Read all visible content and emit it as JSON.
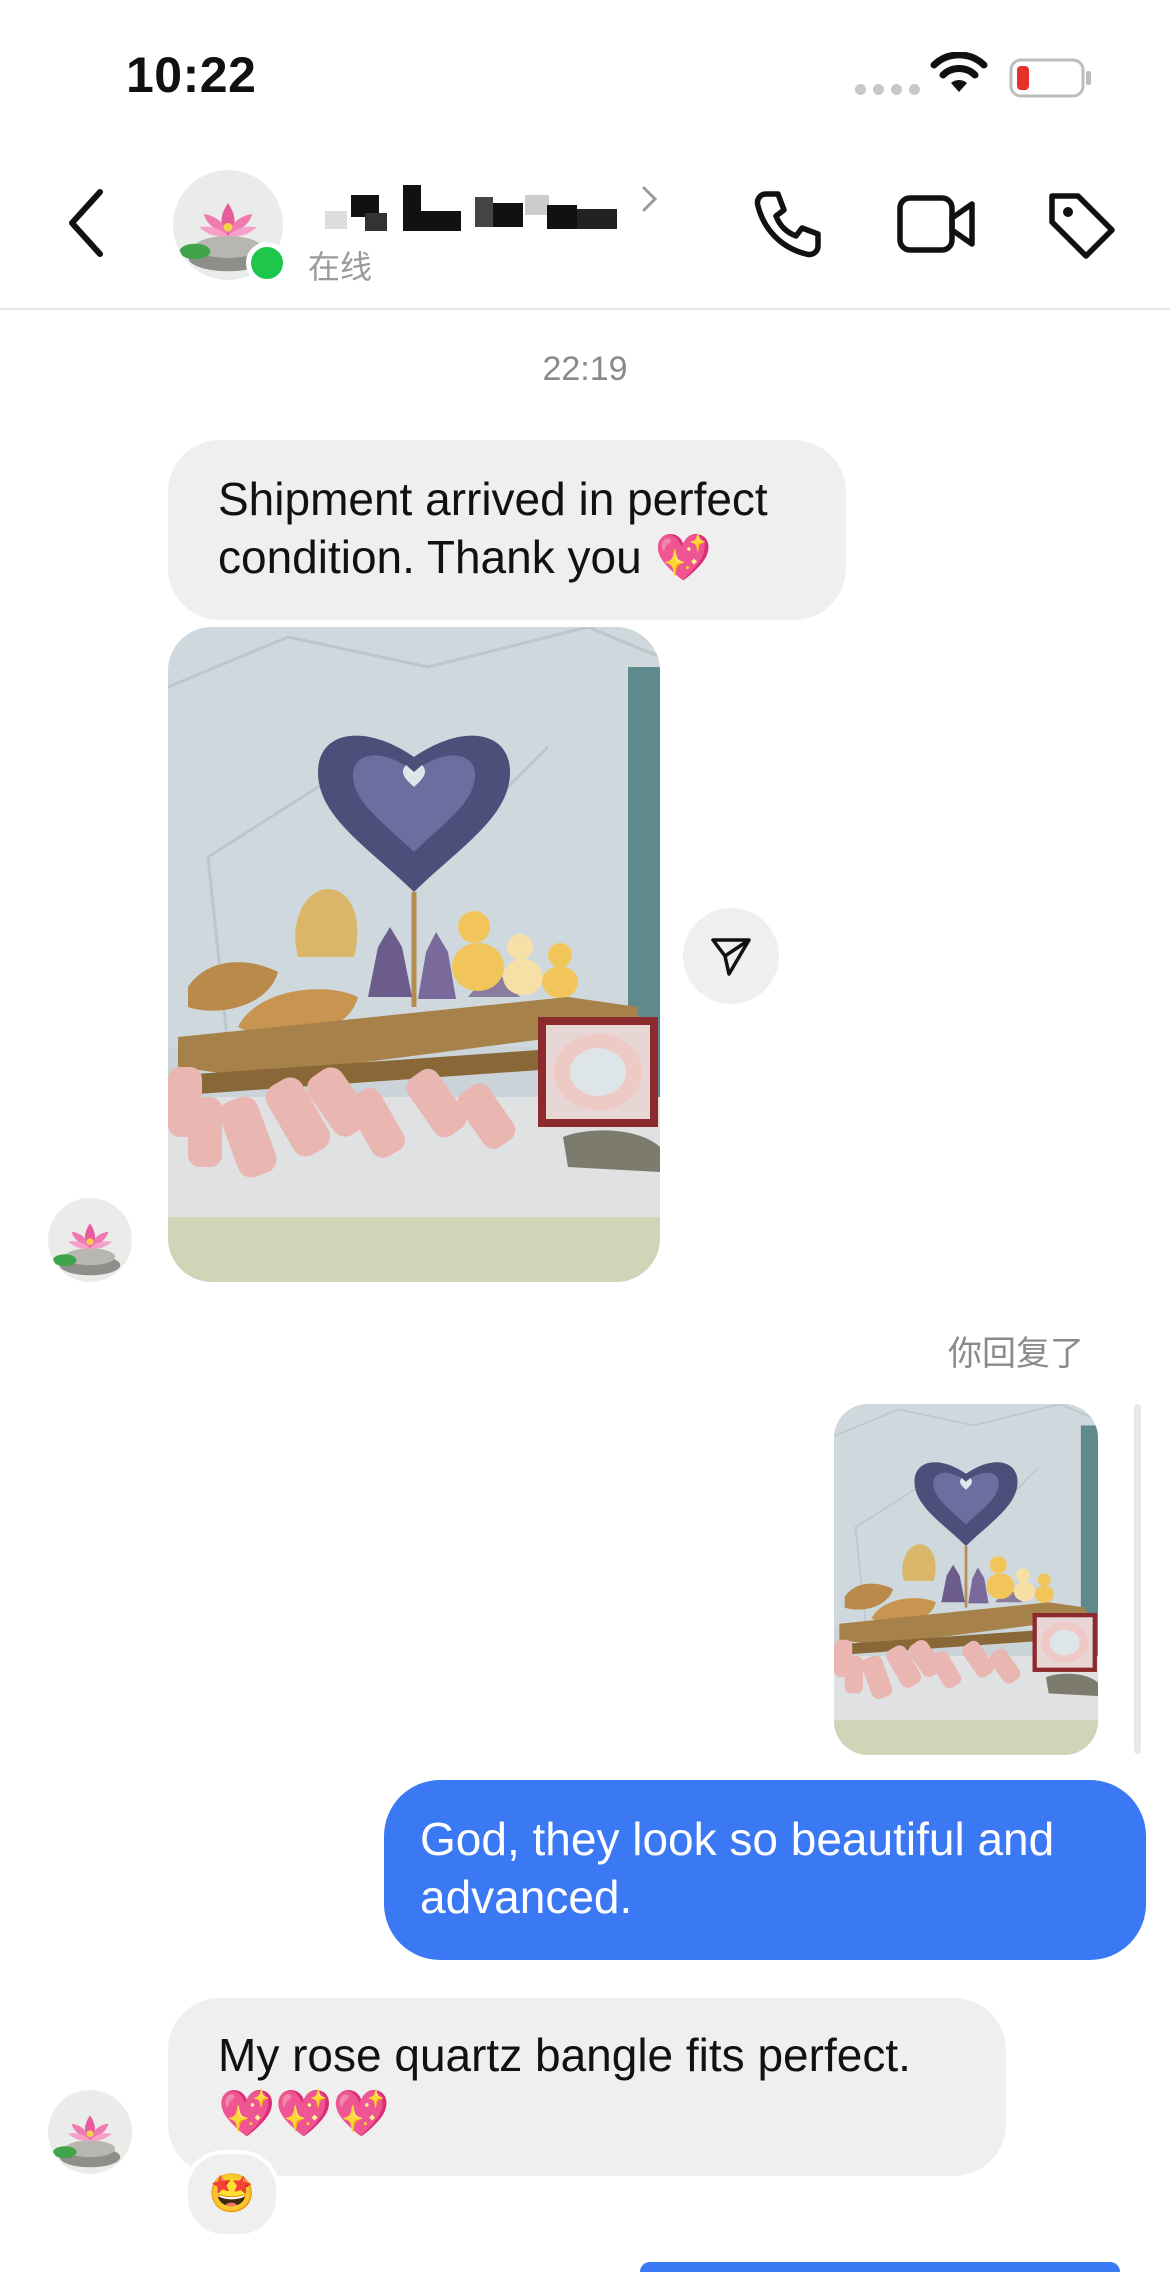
{
  "status_bar": {
    "time": "10:22"
  },
  "header": {
    "contact_status": "在线",
    "colors": {
      "online": "#1ec74b"
    },
    "icons": [
      "chevron-left-icon",
      "phone-icon",
      "video-camera-icon",
      "tag-icon",
      "chevron-right-icon"
    ]
  },
  "chat": {
    "timestamp": "22:19",
    "messages": [
      {
        "from": "them",
        "type": "text",
        "text": "Shipment arrived in perfect condition. Thank you 💖"
      },
      {
        "from": "them",
        "type": "photo",
        "description": "crystals on wooden shelf"
      },
      {
        "from": "me",
        "type": "reply_label",
        "text": "你回复了"
      },
      {
        "from": "me",
        "type": "photo_reply"
      },
      {
        "from": "me",
        "type": "text",
        "text": "God, they look so beautiful and advanced."
      },
      {
        "from": "them",
        "type": "text",
        "text": "My rose quartz bangle fits perfect. 💖💖💖",
        "reaction": "🤩"
      }
    ],
    "colors": {
      "outgoing_bubble": "#3b78f4",
      "incoming_bubble": "#efefef"
    }
  }
}
